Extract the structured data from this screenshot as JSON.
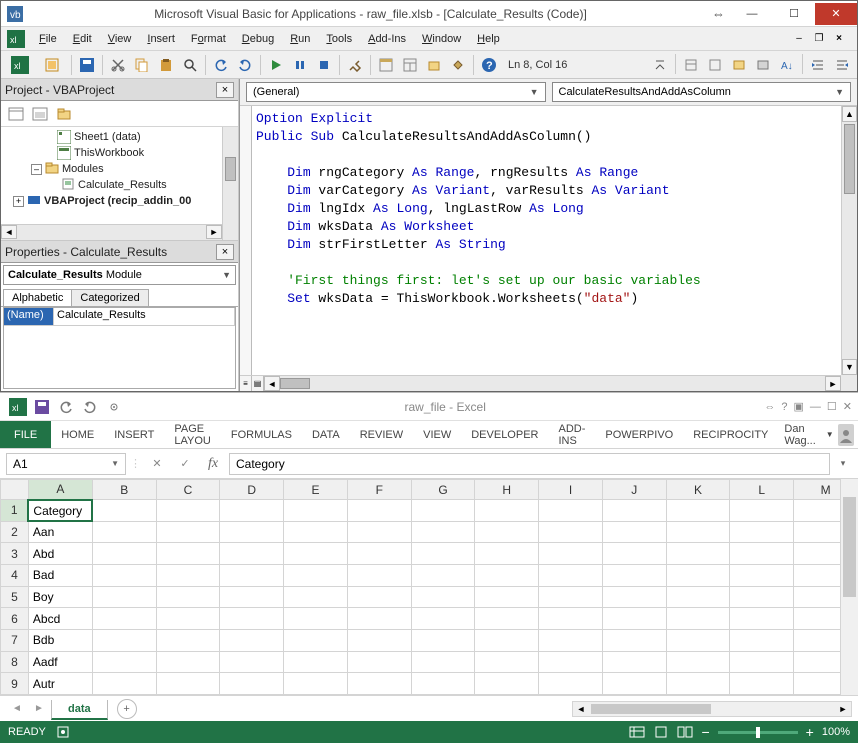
{
  "vba": {
    "title": "Microsoft Visual Basic for Applications - raw_file.xlsb - [Calculate_Results (Code)]",
    "menus": [
      "File",
      "Edit",
      "View",
      "Insert",
      "Format",
      "Debug",
      "Run",
      "Tools",
      "Add-Ins",
      "Window",
      "Help"
    ],
    "toolbar_status": "Ln 8, Col 16",
    "project_panel_title": "Project - VBAProject",
    "project_tree": {
      "sheet1": "Sheet1 (data)",
      "thiswb": "ThisWorkbook",
      "modules": "Modules",
      "calc": "Calculate_Results",
      "recip": "VBAProject (recip_addin_00"
    },
    "properties_panel_title": "Properties - Calculate_Results",
    "properties_combo_name": "Calculate_Results",
    "properties_combo_type": "Module",
    "prop_tabs": {
      "alpha": "Alphabetic",
      "cat": "Categorized"
    },
    "prop_name_label": "(Name)",
    "prop_name_value": "Calculate_Results",
    "code_left_dropdown": "(General)",
    "code_right_dropdown": "CalculateResultsAndAddAsColumn",
    "code_lines": [
      "Option Explicit",
      "Public Sub CalculateResultsAndAddAsColumn()",
      "",
      "    Dim rngCategory As Range, rngResults As Range",
      "    Dim varCategory As Variant, varResults As Variant",
      "    Dim lngIdx As Long, lngLastRow As Long",
      "    Dim wksData As Worksheet",
      "    Dim strFirstLetter As String",
      "",
      "    'First things first: let's set up our basic variables",
      "    Set wksData = ThisWorkbook.Worksheets(\"data\")"
    ]
  },
  "excel": {
    "qat_title": "raw_file - Excel",
    "ribbon_tabs": [
      "FILE",
      "HOME",
      "INSERT",
      "PAGE LAYOU",
      "FORMULAS",
      "DATA",
      "REVIEW",
      "VIEW",
      "DEVELOPER",
      "ADD-INS",
      "POWERPIVO",
      "RECIPROCITY"
    ],
    "user_name": "Dan Wag...",
    "namebox": "A1",
    "formula_value": "Category",
    "columns": [
      "A",
      "B",
      "C",
      "D",
      "E",
      "F",
      "G",
      "H",
      "I",
      "J",
      "K",
      "L",
      "M"
    ],
    "rows": [
      {
        "n": "1",
        "a": "Category"
      },
      {
        "n": "2",
        "a": "Aan"
      },
      {
        "n": "3",
        "a": "Abd"
      },
      {
        "n": "4",
        "a": "Bad"
      },
      {
        "n": "5",
        "a": "Boy"
      },
      {
        "n": "6",
        "a": "Abcd"
      },
      {
        "n": "7",
        "a": "Bdb"
      },
      {
        "n": "8",
        "a": "Aadf"
      },
      {
        "n": "9",
        "a": "Autr"
      }
    ],
    "sheet_tab": "data",
    "status_ready": "READY",
    "zoom": "100%"
  }
}
